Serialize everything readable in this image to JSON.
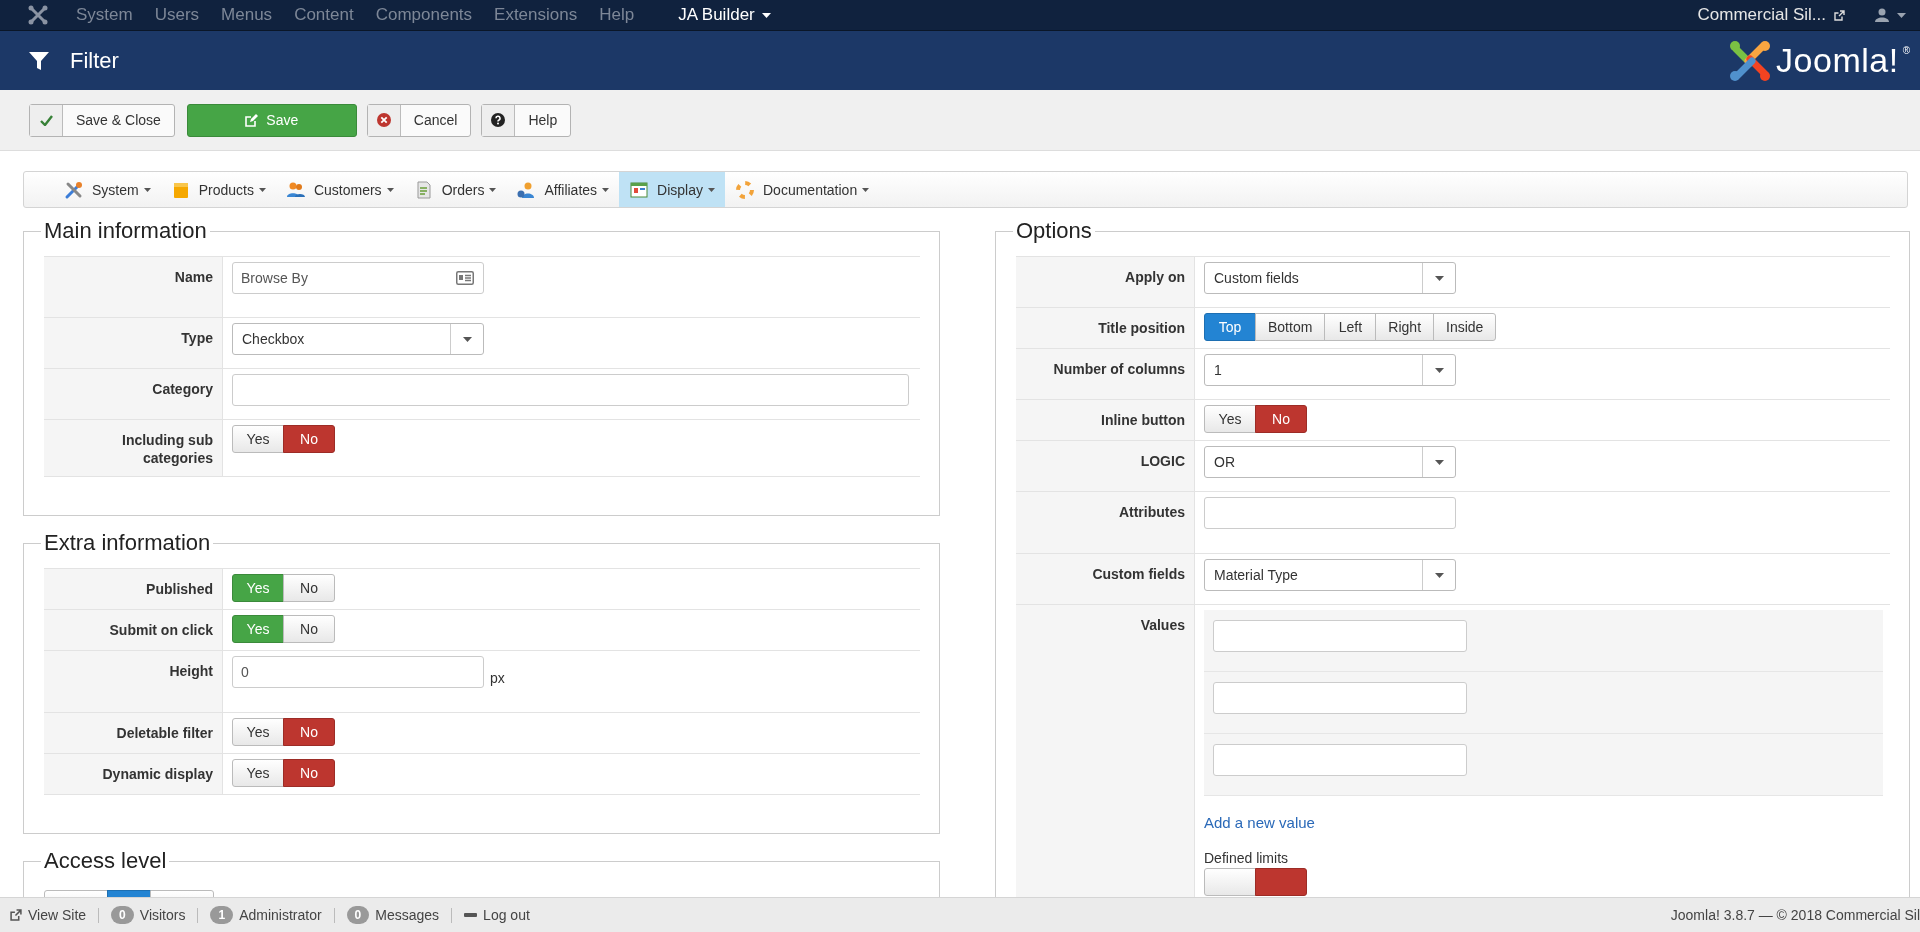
{
  "top_menu": {
    "items": [
      "System",
      "Users",
      "Menus",
      "Content",
      "Components",
      "Extensions",
      "Help"
    ],
    "builder": "JA Builder",
    "site": "Commercial Sil..."
  },
  "header": {
    "title": "Filter",
    "brand": "Joomla!",
    "brand_mark": "®"
  },
  "toolbar": [
    {
      "label": "Save & Close",
      "kind": "check"
    },
    {
      "label": "Save",
      "kind": "primary"
    },
    {
      "label": "Cancel",
      "kind": "cancel"
    },
    {
      "label": "Help",
      "kind": "help"
    }
  ],
  "submenu": [
    {
      "label": "System",
      "kind": "tools",
      "selected": false
    },
    {
      "label": "Products",
      "kind": "box",
      "selected": false
    },
    {
      "label": "Customers",
      "kind": "people",
      "selected": false
    },
    {
      "label": "Orders",
      "kind": "doc",
      "selected": false
    },
    {
      "label": "Affiliates",
      "kind": "affiliate",
      "selected": false
    },
    {
      "label": "Display",
      "kind": "display",
      "selected": true
    },
    {
      "label": "Documentation",
      "kind": "help",
      "selected": false
    }
  ],
  "main_information": {
    "title": "Main information",
    "fields": [
      {
        "label": "Name",
        "kind": "iconinput",
        "value": "Browse By"
      },
      {
        "label": "Type",
        "kind": "select",
        "value": "Checkbox"
      },
      {
        "label": "Category",
        "kind": "wide"
      },
      {
        "label": "Including sub categories",
        "kind": "yesno",
        "options": [
          {
            "label": "Yes",
            "selected": false
          },
          {
            "label": "No",
            "selected": true
          }
        ]
      }
    ]
  },
  "extra_information": {
    "title": "Extra information",
    "fields": [
      {
        "label": "Published",
        "kind": "yesno",
        "options": [
          {
            "label": "Yes",
            "selected": true
          },
          {
            "label": "No",
            "selected": false
          }
        ]
      },
      {
        "label": "Submit on click",
        "kind": "yesno",
        "options": [
          {
            "label": "Yes",
            "selected": true
          },
          {
            "label": "No",
            "selected": false
          }
        ]
      },
      {
        "label": "Height",
        "kind": "suffix",
        "value": "0",
        "suffix": "px"
      },
      {
        "label": "Deletable filter",
        "kind": "yesno",
        "options": [
          {
            "label": "Yes",
            "selected": false
          },
          {
            "label": "No",
            "selected": true
          }
        ]
      },
      {
        "label": "Dynamic display",
        "kind": "yesno",
        "options": [
          {
            "label": "Yes",
            "selected": false
          },
          {
            "label": "No",
            "selected": true
          }
        ]
      }
    ]
  },
  "access_level": {
    "title": "Access level",
    "options": [
      {
        "selected": false
      },
      {
        "selected": true
      },
      {
        "selected": false
      }
    ]
  },
  "options": {
    "title": "Options",
    "fields": [
      {
        "label": "Apply on",
        "kind": "select",
        "value": "Custom fields"
      },
      {
        "label": "Title position",
        "kind": "choice",
        "options": [
          {
            "label": "Top",
            "selected": true
          },
          {
            "label": "Bottom",
            "selected": false
          },
          {
            "label": "Left",
            "selected": false
          },
          {
            "label": "Right",
            "selected": false
          },
          {
            "label": "Inside",
            "selected": false
          }
        ]
      },
      {
        "label": "Number of columns",
        "kind": "select",
        "value": "1"
      },
      {
        "label": "Inline button",
        "kind": "yesno",
        "options": [
          {
            "label": "Yes",
            "selected": false
          },
          {
            "label": "No",
            "selected": true
          }
        ]
      },
      {
        "label": "LOGIC",
        "kind": "select",
        "value": "OR"
      },
      {
        "label": "Attributes",
        "kind": "input"
      },
      {
        "label": "Custom fields",
        "kind": "select",
        "value": "Material Type"
      },
      {
        "label": "Values",
        "kind": "values",
        "inputs": [
          {
            "kind": "input"
          },
          {
            "kind": "input"
          },
          {
            "kind": "input"
          }
        ],
        "link": "Add a new value",
        "limits_label": "Defined limits",
        "limits": [
          {
            "selected": false
          },
          {
            "selected": true
          }
        ]
      }
    ]
  },
  "status_bar": {
    "view_site": "View Site",
    "counters": [
      {
        "count": "0",
        "label": "Visitors"
      },
      {
        "count": "1",
        "label": "Administrator"
      },
      {
        "count": "0",
        "label": "Messages"
      }
    ],
    "logout": "Log out",
    "version": "Joomla! 3.8.7  —  © 2018 Commercial Sil"
  }
}
